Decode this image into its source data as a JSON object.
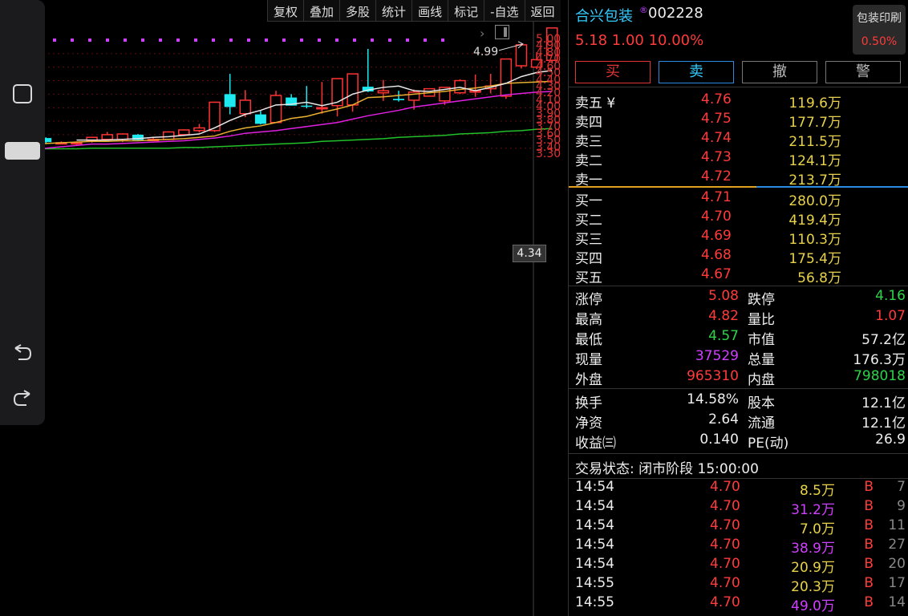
{
  "toolbar": [
    "复权",
    "叠加",
    "多股",
    "统计",
    "画线",
    "标记",
    "-自选",
    "返回"
  ],
  "price_axis": [
    "5.00",
    "4.90",
    "4.80",
    "4.70",
    "4.60",
    "4.50",
    "4.40",
    "4.30",
    "4.20",
    "4.10",
    "4.00",
    "3.90",
    "3.80",
    "3.70",
    "3.60",
    "3.50",
    "3.40",
    "3.30"
  ],
  "current_price_label": "4.34",
  "high_annotation": "4.99",
  "chart_data": {
    "type": "candlestick",
    "ylim": [
      3.3,
      5.05
    ],
    "candles": [
      [
        3.55,
        3.59,
        3.52,
        3.61
      ],
      [
        3.53,
        3.59,
        3.53,
        3.6
      ],
      [
        3.55,
        3.49,
        3.46,
        3.56
      ],
      [
        3.48,
        3.48,
        3.46,
        3.5
      ],
      [
        3.48,
        3.48,
        3.45,
        3.5
      ],
      [
        3.51,
        3.56,
        3.48,
        3.57
      ],
      [
        3.53,
        3.6,
        3.52,
        3.64
      ],
      [
        3.53,
        3.61,
        3.49,
        3.62
      ],
      [
        3.6,
        3.52,
        3.51,
        3.61
      ],
      [
        3.52,
        3.53,
        3.51,
        3.57
      ],
      [
        3.53,
        3.64,
        3.52,
        3.65
      ],
      [
        3.6,
        3.67,
        3.58,
        3.68
      ],
      [
        3.66,
        3.7,
        3.63,
        3.76
      ],
      [
        3.66,
        4.08,
        3.64,
        4.09
      ],
      [
        4.2,
        4.01,
        3.9,
        4.5
      ],
      [
        3.91,
        4.11,
        3.86,
        4.26
      ],
      [
        3.9,
        3.76,
        3.75,
        3.95
      ],
      [
        3.78,
        4.18,
        3.78,
        4.25
      ],
      [
        4.15,
        4.03,
        4.03,
        4.2
      ],
      [
        4.03,
        4.02,
        3.99,
        4.32
      ],
      [
        3.99,
        4.0,
        3.91,
        4.38
      ],
      [
        4.03,
        4.43,
        3.87,
        4.43
      ],
      [
        4.04,
        4.5,
        3.94,
        4.5
      ],
      [
        4.31,
        4.24,
        4.23,
        4.87
      ],
      [
        4.22,
        4.25,
        4.1,
        4.41
      ],
      [
        4.13,
        4.11,
        4.09,
        4.25
      ],
      [
        4.11,
        4.23,
        3.97,
        4.27
      ],
      [
        4.17,
        4.28,
        4.17,
        4.28
      ],
      [
        4.1,
        4.3,
        4.04,
        4.3
      ],
      [
        4.22,
        4.4,
        4.2,
        4.42
      ],
      [
        4.23,
        4.25,
        4.16,
        4.49
      ],
      [
        4.28,
        4.32,
        4.21,
        4.5
      ],
      [
        4.17,
        4.72,
        4.13,
        4.72
      ],
      [
        4.62,
        4.93,
        4.58,
        4.95
      ],
      [
        4.6,
        4.71,
        4.57,
        4.82
      ],
      [
        4.7,
        5.18,
        4.65,
        5.18
      ]
    ],
    "ma_white": [
      null,
      null,
      null,
      null,
      3.52,
      3.52,
      3.52,
      3.53,
      3.54,
      3.56,
      3.57,
      3.59,
      3.61,
      3.7,
      3.81,
      3.9,
      3.96,
      4.04,
      4.05,
      4.08,
      4.03,
      4.08,
      4.2,
      4.26,
      4.3,
      4.32,
      4.25,
      4.24,
      4.27,
      4.3,
      4.25,
      4.3,
      4.36,
      4.46,
      4.52,
      4.55
    ],
    "ma_yellow": [
      3.45,
      3.47,
      3.47,
      3.48,
      3.49,
      3.5,
      3.5,
      3.51,
      3.51,
      3.52,
      3.53,
      3.54,
      3.56,
      3.58,
      3.65,
      3.7,
      3.73,
      3.78,
      3.84,
      3.87,
      3.93,
      3.98,
      4.04,
      4.15,
      4.16,
      4.18,
      4.2,
      4.22,
      4.24,
      4.27,
      4.29,
      4.32,
      4.36,
      4.37,
      4.38,
      4.39
    ],
    "ma_magenta": [
      3.38,
      3.39,
      3.4,
      3.42,
      3.44,
      3.46,
      3.46,
      3.47,
      3.48,
      3.49,
      3.5,
      3.51,
      3.53,
      3.55,
      3.58,
      3.62,
      3.64,
      3.66,
      3.69,
      3.72,
      3.75,
      3.78,
      3.83,
      3.88,
      3.92,
      3.96,
      4.01,
      4.04,
      4.07,
      4.1,
      4.13,
      4.16,
      4.19,
      4.21,
      4.23,
      4.24
    ],
    "ma_green": [
      3.39,
      3.39,
      3.39,
      3.39,
      3.39,
      3.4,
      3.4,
      3.4,
      3.4,
      3.4,
      3.4,
      3.41,
      3.41,
      3.42,
      3.43,
      3.44,
      3.45,
      3.46,
      3.47,
      3.48,
      3.5,
      3.51,
      3.52,
      3.53,
      3.54,
      3.56,
      3.57,
      3.58,
      3.59,
      3.61,
      3.62,
      3.63,
      3.65,
      3.66,
      3.68,
      3.69
    ]
  },
  "stock": {
    "name": "合兴包装",
    "badge": "®",
    "code": "002228",
    "quote": "5.18 1.00 10.00%",
    "industry_name": "包装印刷",
    "industry_change": "0.50%"
  },
  "buttons": [
    "买",
    "卖",
    "撤",
    "警"
  ],
  "asks": [
    {
      "label": "卖五 ¥",
      "price": "4.76",
      "vol": "119.6万"
    },
    {
      "label": "卖四",
      "price": "4.75",
      "vol": "177.7万"
    },
    {
      "label": "卖三",
      "price": "4.74",
      "vol": "211.5万"
    },
    {
      "label": "卖二",
      "price": "4.73",
      "vol": "124.1万"
    },
    {
      "label": "卖一",
      "price": "4.72",
      "vol": "213.7万"
    }
  ],
  "bids": [
    {
      "label": "买一",
      "price": "4.71",
      "vol": "280.0万"
    },
    {
      "label": "买二",
      "price": "4.70",
      "vol": "419.4万"
    },
    {
      "label": "买三",
      "price": "4.69",
      "vol": "110.3万"
    },
    {
      "label": "买四",
      "price": "4.68",
      "vol": "175.4万"
    },
    {
      "label": "买五",
      "price": "4.67",
      "vol": "56.8万"
    }
  ],
  "stats1": [
    {
      "l1": "涨停",
      "v1": "5.08",
      "l2": "跌停",
      "v2": "4.16"
    },
    {
      "l1": "最高",
      "v1": "4.82",
      "l2": "量比",
      "v2": "1.07"
    },
    {
      "l1": "最低",
      "v1": "4.57",
      "l2": "市值",
      "v2": "57.2亿"
    },
    {
      "l1": "现量",
      "v1": "37529",
      "l2": "总量",
      "v2": "176.3万"
    },
    {
      "l1": "外盘",
      "v1": "965310",
      "l2": "内盘",
      "v2": "798018"
    }
  ],
  "stats2": [
    {
      "l1": "换手",
      "v1": "14.58%",
      "l2": "股本",
      "v2": "12.1亿"
    },
    {
      "l1": "净资",
      "v1": "2.64",
      "l2": "流通",
      "v2": "12.1亿"
    },
    {
      "l1": "收益㈢",
      "v1": "0.140",
      "l2": "PE(动)",
      "v2": "26.9"
    }
  ],
  "trade_status": "交易状态: 闭市阶段 15:00:00",
  "ticks": [
    {
      "time": "14:54",
      "price": "4.70",
      "vol": "8.5万",
      "side": "B",
      "n": "7"
    },
    {
      "time": "14:54",
      "price": "4.70",
      "vol": "31.2万",
      "side": "B",
      "n": "9"
    },
    {
      "time": "14:54",
      "price": "4.70",
      "vol": "7.0万",
      "side": "B",
      "n": "11"
    },
    {
      "time": "14:54",
      "price": "4.70",
      "vol": "38.9万",
      "side": "B",
      "n": "27"
    },
    {
      "time": "14:54",
      "price": "4.70",
      "vol": "20.9万",
      "side": "B",
      "n": "20"
    },
    {
      "time": "14:55",
      "price": "4.70",
      "vol": "20.3万",
      "side": "B",
      "n": "17"
    },
    {
      "time": "14:55",
      "price": "4.70",
      "vol": "49.0万",
      "side": "B",
      "n": "14"
    }
  ]
}
